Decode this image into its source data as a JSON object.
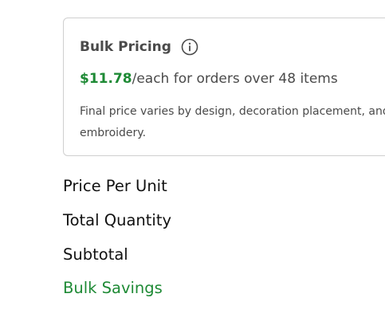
{
  "bulk_pricing": {
    "title": "Bulk Pricing",
    "price": "$11.78",
    "price_suffix": "/each for orders over 48 items",
    "note": "Final price varies by design, decoration placement, and embroidery.",
    "info_icon": "info-circle-icon"
  },
  "summary": {
    "price_per_unit_label": "Price Per Unit",
    "total_quantity_label": "Total Quantity",
    "subtotal_label": "Subtotal",
    "bulk_savings_label": "Bulk Savings"
  },
  "colors": {
    "accent_green": "#1e8a35",
    "text": "#4a4a4a",
    "border": "#cfcfcf"
  }
}
